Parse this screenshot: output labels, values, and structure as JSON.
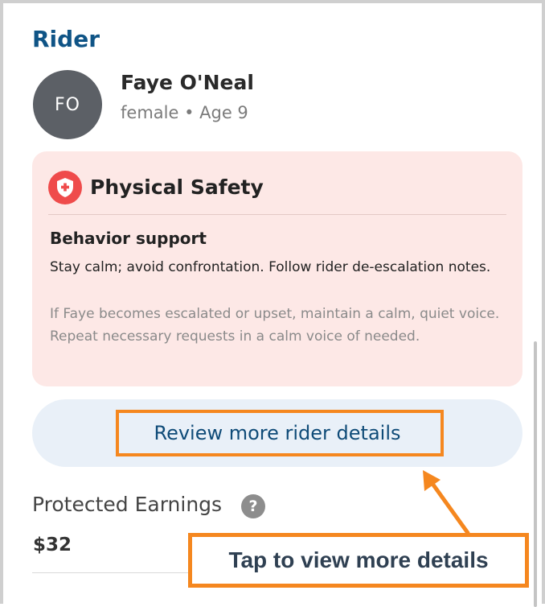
{
  "section": {
    "title": "Rider"
  },
  "rider": {
    "initials": "FO",
    "name": "Faye O'Neal",
    "meta": "female • Age 9"
  },
  "safety": {
    "title": "Physical Safety",
    "icon": "shield-plus-icon",
    "heading": "Behavior support",
    "summary": "Stay calm; avoid confrontation. Follow rider de-escalation notes.",
    "notes": "If Faye becomes escalated or upset, maintain a calm, quiet voice. Repeat necessary requests in a calm voice of needed."
  },
  "review": {
    "label": "Review more rider details"
  },
  "earnings": {
    "label": "Protected Earnings",
    "help_glyph": "?",
    "value": "$32"
  },
  "callout": {
    "text": "Tap to view more details"
  },
  "colors": {
    "accent": "#0f5486",
    "highlight": "#f5871f",
    "safety_bg": "#fde8e6",
    "safety_icon": "#ef4b4b",
    "pill_bg": "#e9f0f8"
  }
}
